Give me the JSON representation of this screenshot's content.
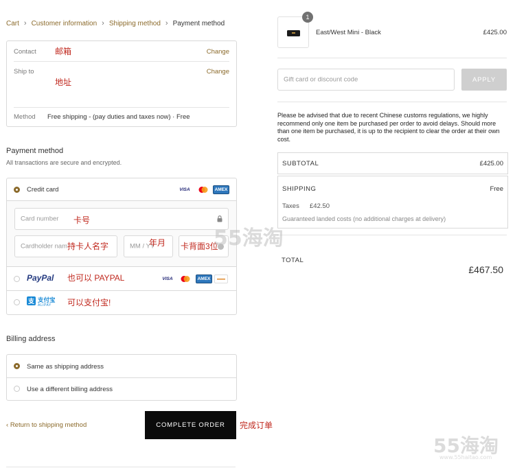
{
  "breadcrumb": {
    "cart": "Cart",
    "customer_info": "Customer information",
    "shipping_method": "Shipping method",
    "payment_method": "Payment method"
  },
  "info_box": {
    "contact_label": "Contact",
    "contact_annotation": "邮箱",
    "contact_change": "Change",
    "ship_to_label": "Ship to",
    "ship_to_annotation": "地址",
    "ship_to_change": "Change",
    "method_label": "Method",
    "method_value": "Free shipping - (pay duties and taxes now) · Free"
  },
  "payment": {
    "title": "Payment method",
    "subtitle": "All transactions are secure and encrypted.",
    "credit_card_label": "Credit card",
    "card_number_placeholder": "Card number",
    "card_number_annotation": "卡号",
    "cardholder_placeholder": "Cardholder name",
    "cardholder_annotation": "持卡人名字",
    "expiry_placeholder": "MM / YY",
    "expiry_annotation": "年月",
    "cvv_annotation": "卡背面3位",
    "paypal_label": "PayPal",
    "paypal_annotation": "也可以 PAYPAL",
    "alipay_label": "支付宝",
    "alipay_sub": "ALIPAY",
    "alipay_annotation": "可以支付宝!",
    "logos": {
      "visa": "VISA",
      "amex": "AMEX"
    }
  },
  "billing": {
    "title": "Billing address",
    "same_label": "Same as shipping address",
    "different_label": "Use a different billing address"
  },
  "footer": {
    "return_link": "Return to shipping method",
    "complete_button": "COMPLETE ORDER",
    "complete_annotation": "完成订单"
  },
  "summary": {
    "item_badge": "1",
    "item_name": "East/West Mini - Black",
    "item_price": "£425.00",
    "discount_placeholder": "Gift card or discount code",
    "apply_label": "APPLY",
    "notice": "Please be advised that due to recent Chinese customs regulations, we highly recommend only one item be purchased per order to avoid delays. Should more than one item be purchased, it is up to the recipient to clear the order at their own cost.",
    "subtotal_label": "SUBTOTAL",
    "subtotal_value": "£425.00",
    "shipping_label": "SHIPPING",
    "shipping_value": "Free",
    "taxes_label": "Taxes",
    "taxes_value": "£42.50",
    "landed_note": "Guaranteed landed costs (no additional charges at delivery)",
    "total_label": "TOTAL",
    "total_value": "£467.50"
  },
  "watermark": {
    "center": "55海淘",
    "corner": "55海淘",
    "corner_url": "www.55haitao.com"
  },
  "colors": {
    "accent": "#8b6a2b",
    "annotation": "#c0281e",
    "button": "#0b0b0b"
  }
}
